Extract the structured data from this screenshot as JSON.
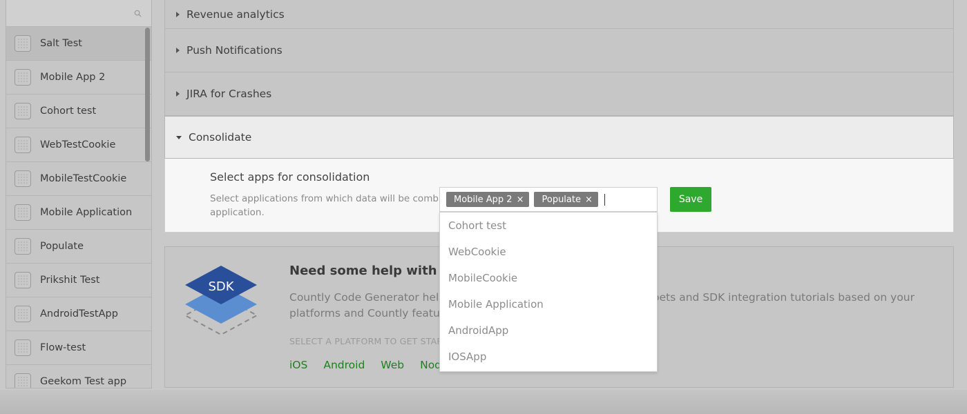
{
  "sidebar": {
    "items": [
      {
        "label": "Salt Test"
      },
      {
        "label": "Mobile App 2"
      },
      {
        "label": "Cohort test"
      },
      {
        "label": "WebTestCookie"
      },
      {
        "label": "MobileTestCookie"
      },
      {
        "label": "Mobile Application"
      },
      {
        "label": "Populate"
      },
      {
        "label": "Prikshit Test"
      },
      {
        "label": "AndroidTestApp"
      },
      {
        "label": "Flow-test"
      },
      {
        "label": "Geekom Test app"
      }
    ]
  },
  "accordion": {
    "revenue": "Revenue analytics",
    "push": "Push Notifications",
    "jira": "JIRA for Crashes",
    "consolidate": "Consolidate"
  },
  "consolidate": {
    "title": "Select apps for consolidation",
    "description": "Select applications from which data will be combined into this application.",
    "tags": [
      "Mobile App 2",
      "Populate"
    ],
    "tag_remove": "×",
    "options": [
      "Cohort test",
      "WebCookie",
      "MobileCookie",
      "Mobile Application",
      "AndroidApp",
      "IOSApp"
    ],
    "save_label": "Save"
  },
  "sdk": {
    "badge": "SDK",
    "title": "Need some help with SDK integration?",
    "description": "Countly Code Generator helps you generate personalized code snippets and SDK integration tutorials based on your platforms and Countly features you want to use.",
    "hint": "SELECT A PLATFORM TO GET STARTED",
    "platforms": [
      "iOS",
      "Android",
      "Web",
      "NodeJS"
    ]
  },
  "colors": {
    "save": "#2fa82f",
    "link": "#1e7f1e",
    "tag": "#7a7a7a"
  }
}
